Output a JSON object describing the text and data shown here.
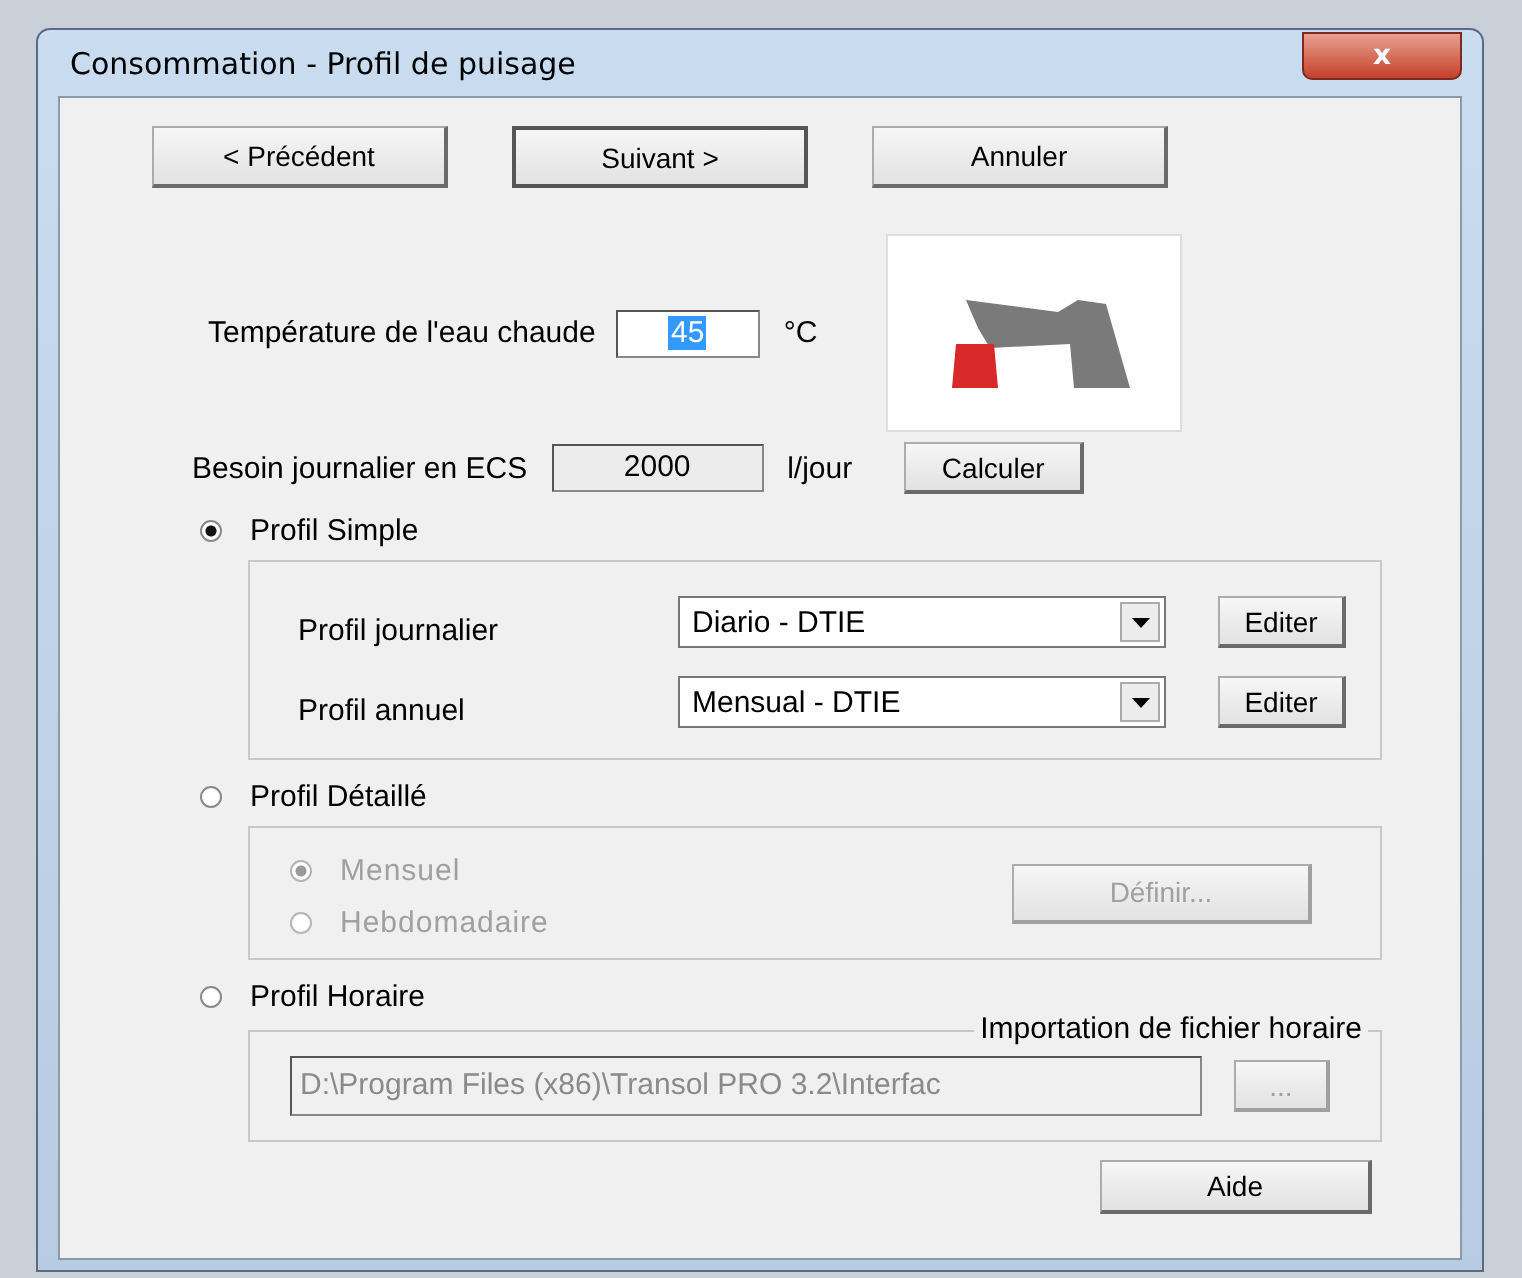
{
  "window": {
    "title": "Consommation - Profil de puisage",
    "close": "x"
  },
  "nav_buttons": [
    {
      "label": "< Précédent",
      "default": false
    },
    {
      "label": "Suivant >",
      "default": true
    },
    {
      "label": "Annuler",
      "default": false
    }
  ],
  "temperature": {
    "label": "Température de l'eau chaude",
    "value": "45",
    "value_selected": true,
    "unit": "°C"
  },
  "daily_need": {
    "label": "Besoin journalier en ECS",
    "value": "2000",
    "readonly": true,
    "unit": "l/jour",
    "button": "Calculer"
  },
  "profiles": [
    {
      "kind": "simple",
      "label": "Profil Simple",
      "selected": true,
      "rows": [
        {
          "label": "Profil journalier",
          "value": "Diario - DTIE",
          "button": "Editer"
        },
        {
          "label": "Profil annuel",
          "value": "Mensual - DTIE",
          "button": "Editer"
        }
      ]
    },
    {
      "kind": "detailed",
      "label": "Profil Détaillé",
      "selected": false,
      "disabled": true,
      "options": [
        {
          "label": "Mensuel",
          "selected": true
        },
        {
          "label": "Hebdomadaire",
          "selected": false
        }
      ],
      "button": "Définir..."
    },
    {
      "kind": "hourly",
      "label": "Profil Horaire",
      "selected": false,
      "disabled": true,
      "legend": "Importation de fichier horaire",
      "path": "D:\\Program Files (x86)\\Transol PRO 3.2\\Interfac",
      "browse": "..."
    }
  ],
  "help_button": "Aide"
}
